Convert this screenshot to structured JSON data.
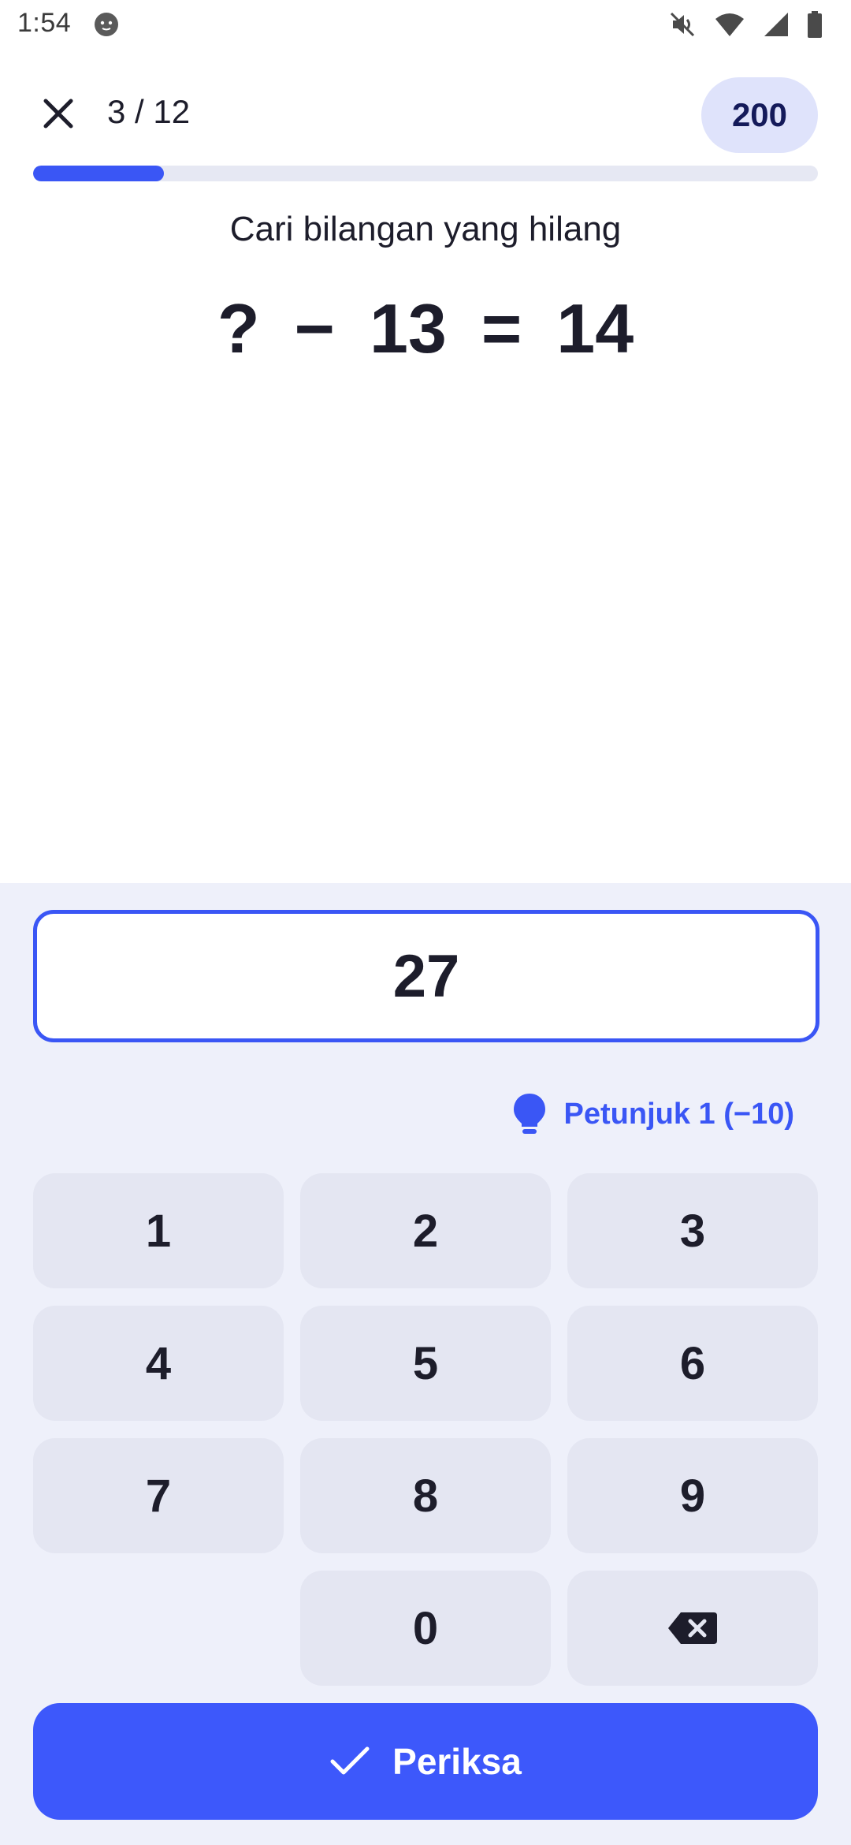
{
  "status_bar": {
    "time": "1:54",
    "icons": [
      "app-face-icon",
      "mute-icon",
      "wifi-icon",
      "signal-icon",
      "battery-icon"
    ]
  },
  "header": {
    "close_icon": "close-icon",
    "progress_text": "3 / 12",
    "score": "200",
    "progress_fraction": 0.167
  },
  "question": {
    "prompt": "Cari bilangan yang hilang",
    "equation": {
      "unknown": "?",
      "operator": "−",
      "operand": "13",
      "equals": "=",
      "result": "14"
    }
  },
  "answer": {
    "value": "27"
  },
  "hint": {
    "icon": "lightbulb-icon",
    "label": "Petunjuk 1 (−10)"
  },
  "keypad": {
    "keys": [
      "1",
      "2",
      "3",
      "4",
      "5",
      "6",
      "7",
      "8",
      "9",
      "0"
    ],
    "backspace_icon": "backspace-icon"
  },
  "check_button": {
    "icon": "check-icon",
    "label": "Periksa"
  },
  "colors": {
    "accent": "#3a56f5",
    "panel_bg": "#eef0fa",
    "key_bg": "#e4e6f2",
    "badge_bg": "#dfe3fb"
  }
}
